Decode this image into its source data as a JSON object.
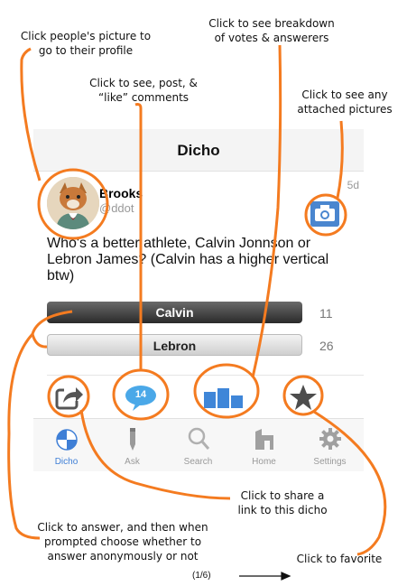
{
  "annotations": {
    "profile": "Click people's picture to go to their profile",
    "comments": "Click to see, post, & “like” comments",
    "votes": "Click to see breakdown of votes & answerers",
    "pictures": "Click to see any attached pictures",
    "share": "Click to share a link to this dicho",
    "answer": "Click to answer, and then when prompted choose whether to answer anonymously or not",
    "favorite": "Click to favorite"
  },
  "app": {
    "title": "Dicho"
  },
  "post": {
    "user_name": "Brooks",
    "user_handle": "@ddot",
    "time": "5d",
    "question": "Who's a better athlete, Calvin Jonnson or Lebron James? (Calvin has a higher vertical btw)",
    "answers": [
      {
        "label": "Calvin",
        "count": "11"
      },
      {
        "label": "Lebron",
        "count": "26"
      }
    ],
    "comment_count": "14"
  },
  "tabs": [
    {
      "label": "Dicho",
      "icon": "dicho-icon",
      "active": true
    },
    {
      "label": "Ask",
      "icon": "pencil-icon",
      "active": false
    },
    {
      "label": "Search",
      "icon": "magnifier-icon",
      "active": false
    },
    {
      "label": "Home",
      "icon": "house-icon",
      "active": false
    },
    {
      "label": "Settings",
      "icon": "gear-icon",
      "active": false
    }
  ],
  "footer": {
    "page": "(1/6)"
  },
  "colors": {
    "accent": "#3f7fd6",
    "annotation": "#f47b20"
  }
}
